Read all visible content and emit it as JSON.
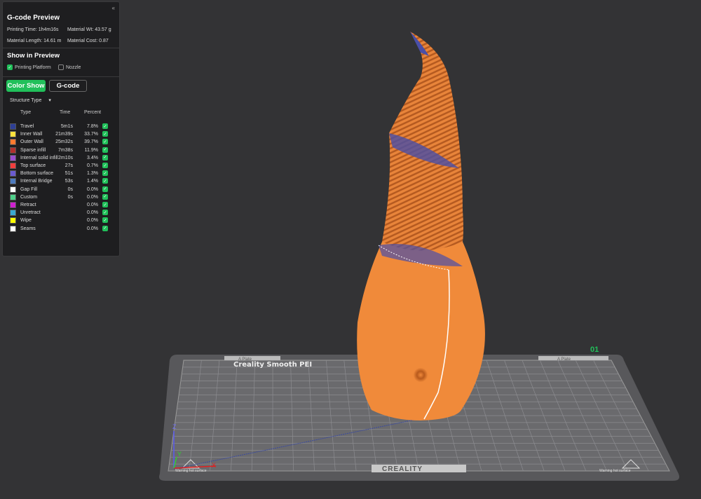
{
  "panel": {
    "collapse_icon": "double-chevron-left",
    "title": "G-code Preview",
    "printing_time": "Printing Time: 1h4m16s",
    "material_wt": "Material Wt: 43.57 g",
    "material_length": "Material Length: 14.61 m",
    "material_cost": "Material Cost: 0.87",
    "show_in_preview": "Show in Preview",
    "printing_platform": "Printing Platform",
    "nozzle": "Nozzle",
    "color_show": "Color Show",
    "gcode": "G-code",
    "structure_type": "Structure Type",
    "headers": {
      "type": "Type",
      "time": "Time",
      "percent": "Percent"
    },
    "rows": [
      {
        "name": "Travel",
        "time": "5m1s",
        "percent": "7.8%",
        "color": "#2e3f96"
      },
      {
        "name": "Inner Wall",
        "time": "21m39s",
        "percent": "33.7%",
        "color": "#ffe23d"
      },
      {
        "name": "Outer Wall",
        "time": "25m32s",
        "percent": "39.7%",
        "color": "#ff7a2f"
      },
      {
        "name": "Sparse infill",
        "time": "7m38s",
        "percent": "11.9%",
        "color": "#b0302e"
      },
      {
        "name": "Internal solid infill",
        "time": "2m10s",
        "percent": "3.4%",
        "color": "#9a4fd0"
      },
      {
        "name": "Top surface",
        "time": "27s",
        "percent": "0.7%",
        "color": "#f03e3e"
      },
      {
        "name": "Bottom surface",
        "time": "51s",
        "percent": "1.3%",
        "color": "#6a5bd0"
      },
      {
        "name": "Internal Bridge",
        "time": "53s",
        "percent": "1.4%",
        "color": "#4d7bbf"
      },
      {
        "name": "Gap Fill",
        "time": "0s",
        "percent": "0.0%",
        "color": "#ffffff"
      },
      {
        "name": "Custom",
        "time": "0s",
        "percent": "0.0%",
        "color": "#4fd08a"
      },
      {
        "name": "Retract",
        "time": "",
        "percent": "0.0%",
        "color": "#d020d0"
      },
      {
        "name": "Unretract",
        "time": "",
        "percent": "0.0%",
        "color": "#3aa8d0"
      },
      {
        "name": "Wipe",
        "time": "",
        "percent": "0.0%",
        "color": "#ffff00"
      },
      {
        "name": "Seams",
        "time": "",
        "percent": "0.0%",
        "color": "#ffffff"
      }
    ]
  },
  "scene": {
    "plate_number": "01",
    "plate_label_left": "A Plate",
    "plate_label_right": "A Plate",
    "bed_text": "Creality Smooth PEI",
    "brand": "CREALITY",
    "warning_left": "Warning hot surface",
    "warning_right": "Warning hot surface",
    "axis_x": "X",
    "axis_y": "Y",
    "axis_z": "Z"
  }
}
